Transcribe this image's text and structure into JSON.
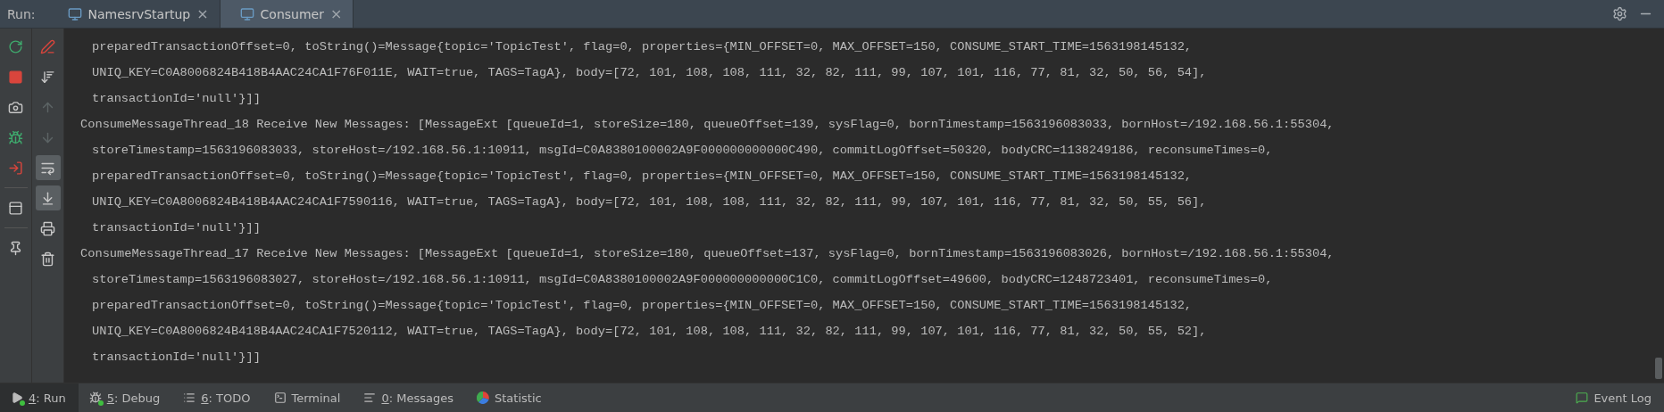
{
  "run_bar": {
    "label": "Run:",
    "tabs": [
      {
        "label": "NamesrvStartup",
        "selected": false,
        "close": "×"
      },
      {
        "label": "Consumer",
        "selected": true,
        "close": "×"
      }
    ]
  },
  "toolbar_primary": [
    {
      "kind": "rerun",
      "disabled": false
    },
    {
      "kind": "stop",
      "disabled": false
    },
    {
      "kind": "camera",
      "disabled": false
    },
    {
      "kind": "bug",
      "disabled": false
    },
    {
      "kind": "exit",
      "disabled": false
    },
    {
      "kind": "layout",
      "disabled": false
    },
    {
      "kind": "pin",
      "disabled": false
    }
  ],
  "toolbar_secondary": [
    {
      "kind": "clear",
      "selected": false,
      "disabled": false
    },
    {
      "kind": "sort",
      "selected": false,
      "disabled": false
    },
    {
      "kind": "up",
      "selected": false,
      "disabled": true
    },
    {
      "kind": "down",
      "selected": false,
      "disabled": true
    },
    {
      "kind": "wrap",
      "selected": true,
      "disabled": false
    },
    {
      "kind": "scroll",
      "selected": true,
      "disabled": false
    },
    {
      "kind": "print",
      "selected": false,
      "disabled": false
    },
    {
      "kind": "trash",
      "selected": false,
      "disabled": false
    }
  ],
  "console": {
    "lines": [
      {
        "kind": "wrap",
        "text": "preparedTransactionOffset=0, toString()=Message{topic='TopicTest', flag=0, properties={MIN_OFFSET=0, MAX_OFFSET=150, CONSUME_START_TIME=1563198145132,"
      },
      {
        "kind": "wrap",
        "text": "UNIQ_KEY=C0A8006824B418B4AAC24CA1F76F011E, WAIT=true, TAGS=TagA}, body=[72, 101, 108, 108, 111, 32, 82, 111, 99, 107, 101, 116, 77, 81, 32, 50, 56, 54],"
      },
      {
        "kind": "wrap",
        "text": "transactionId='null'}]]"
      },
      {
        "kind": "head",
        "text": "ConsumeMessageThread_18 Receive New Messages: [MessageExt [queueId=1, storeSize=180, queueOffset=139, sysFlag=0, bornTimestamp=1563196083033, bornHost=/192.168.56.1:55304,"
      },
      {
        "kind": "wrap",
        "text": "storeTimestamp=1563196083033, storeHost=/192.168.56.1:10911, msgId=C0A8380100002A9F000000000000C490, commitLogOffset=50320, bodyCRC=1138249186, reconsumeTimes=0,"
      },
      {
        "kind": "wrap",
        "text": "preparedTransactionOffset=0, toString()=Message{topic='TopicTest', flag=0, properties={MIN_OFFSET=0, MAX_OFFSET=150, CONSUME_START_TIME=1563198145132,"
      },
      {
        "kind": "wrap",
        "text": "UNIQ_KEY=C0A8006824B418B4AAC24CA1F7590116, WAIT=true, TAGS=TagA}, body=[72, 101, 108, 108, 111, 32, 82, 111, 99, 107, 101, 116, 77, 81, 32, 50, 55, 56],"
      },
      {
        "kind": "wrap",
        "text": "transactionId='null'}]]"
      },
      {
        "kind": "head",
        "text": "ConsumeMessageThread_17 Receive New Messages: [MessageExt [queueId=1, storeSize=180, queueOffset=137, sysFlag=0, bornTimestamp=1563196083026, bornHost=/192.168.56.1:55304,"
      },
      {
        "kind": "wrap",
        "text": "storeTimestamp=1563196083027, storeHost=/192.168.56.1:10911, msgId=C0A8380100002A9F000000000000C1C0, commitLogOffset=49600, bodyCRC=1248723401, reconsumeTimes=0,"
      },
      {
        "kind": "wrap",
        "text": "preparedTransactionOffset=0, toString()=Message{topic='TopicTest', flag=0, properties={MIN_OFFSET=0, MAX_OFFSET=150, CONSUME_START_TIME=1563198145132,"
      },
      {
        "kind": "wrap",
        "text": "UNIQ_KEY=C0A8006824B418B4AAC24CA1F7520112, WAIT=true, TAGS=TagA}, body=[72, 101, 108, 108, 111, 32, 82, 111, 99, 107, 101, 116, 77, 81, 32, 50, 55, 52],"
      },
      {
        "kind": "wrap",
        "text": "transactionId='null'}]]"
      }
    ]
  },
  "bottom_bar": {
    "tabs": [
      {
        "kind": "run",
        "key": "4",
        "label": ": Run",
        "selected": true
      },
      {
        "kind": "debug",
        "key": "5",
        "label": ": Debug",
        "selected": false
      },
      {
        "kind": "todo",
        "key": "6",
        "label": ": TODO",
        "selected": false
      },
      {
        "kind": "terminal",
        "label": "Terminal",
        "selected": false
      },
      {
        "kind": "messages",
        "key": "0",
        "label": ": Messages",
        "selected": false
      },
      {
        "kind": "statistic",
        "label": "Statistic",
        "selected": false
      }
    ],
    "right": {
      "label": "Event Log"
    }
  }
}
